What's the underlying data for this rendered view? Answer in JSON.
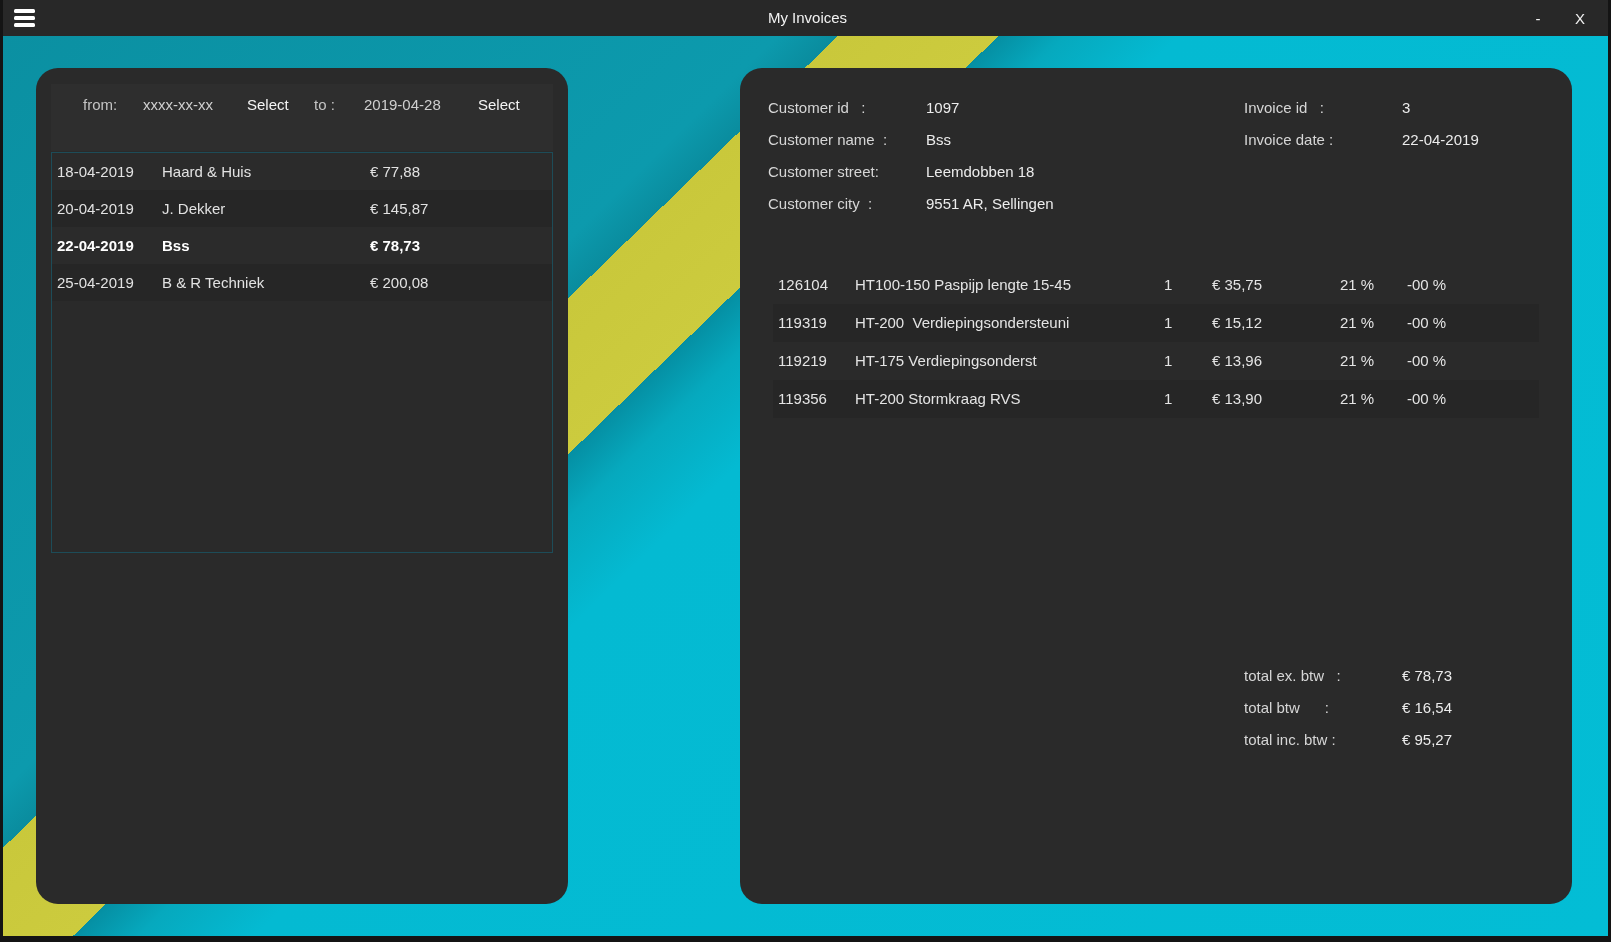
{
  "window": {
    "title": "My Invoices",
    "minimize_button": "-",
    "close_button": "X"
  },
  "date_filter": {
    "from_label": "from:",
    "from_value": "xxxx-xx-xx",
    "from_button": "Select",
    "to_label": "to :",
    "to_value": "2019-04-28",
    "to_button": "Select"
  },
  "invoices": [
    {
      "date": "18-04-2019",
      "customer": "Haard & Huis",
      "amount": "€ 77,88",
      "selected": false
    },
    {
      "date": "20-04-2019",
      "customer": "J. Dekker",
      "amount": "€ 145,87",
      "selected": false
    },
    {
      "date": "22-04-2019",
      "customer": "Bss",
      "amount": "€ 78,73",
      "selected": true
    },
    {
      "date": "25-04-2019",
      "customer": "B & R Techniek",
      "amount": "€ 200,08",
      "selected": false
    }
  ],
  "customer_details": [
    {
      "label": "Customer id   :",
      "value": "1097"
    },
    {
      "label": "Customer name  :",
      "value": "Bss"
    },
    {
      "label": "Customer street:",
      "value": "Leemdobben 18"
    },
    {
      "label": "Customer city  :",
      "value": "9551 AR, Sellingen"
    }
  ],
  "invoice_details": [
    {
      "label": "Invoice id   :",
      "value": "3"
    },
    {
      "label": "Invoice date :",
      "value": "22-04-2019"
    }
  ],
  "invoice_lines": [
    {
      "code": "126104",
      "description": "HT100-150 Paspijp lengte 15-45",
      "quantity": "1",
      "price": "€ 35,75",
      "vat": "21 %",
      "discount": "-00 %"
    },
    {
      "code": "119319",
      "description": "HT-200  Verdiepingsondersteuni",
      "quantity": "1",
      "price": "€ 15,12",
      "vat": "21 %",
      "discount": "-00 %"
    },
    {
      "code": "119219",
      "description": "HT-175 Verdiepingsonderst",
      "quantity": "1",
      "price": "€ 13,96",
      "vat": "21 %",
      "discount": "-00 %"
    },
    {
      "code": "119356",
      "description": "HT-200 Stormkraag RVS",
      "quantity": "1",
      "price": "€ 13,90",
      "vat": "21 %",
      "discount": "-00 %"
    }
  ],
  "totals": [
    {
      "label": "total ex. btw   :",
      "value": "€ 78,73"
    },
    {
      "label": "total btw      :",
      "value": "€ 16,54"
    },
    {
      "label": "total inc. btw :",
      "value": "€ 95,27"
    }
  ]
}
